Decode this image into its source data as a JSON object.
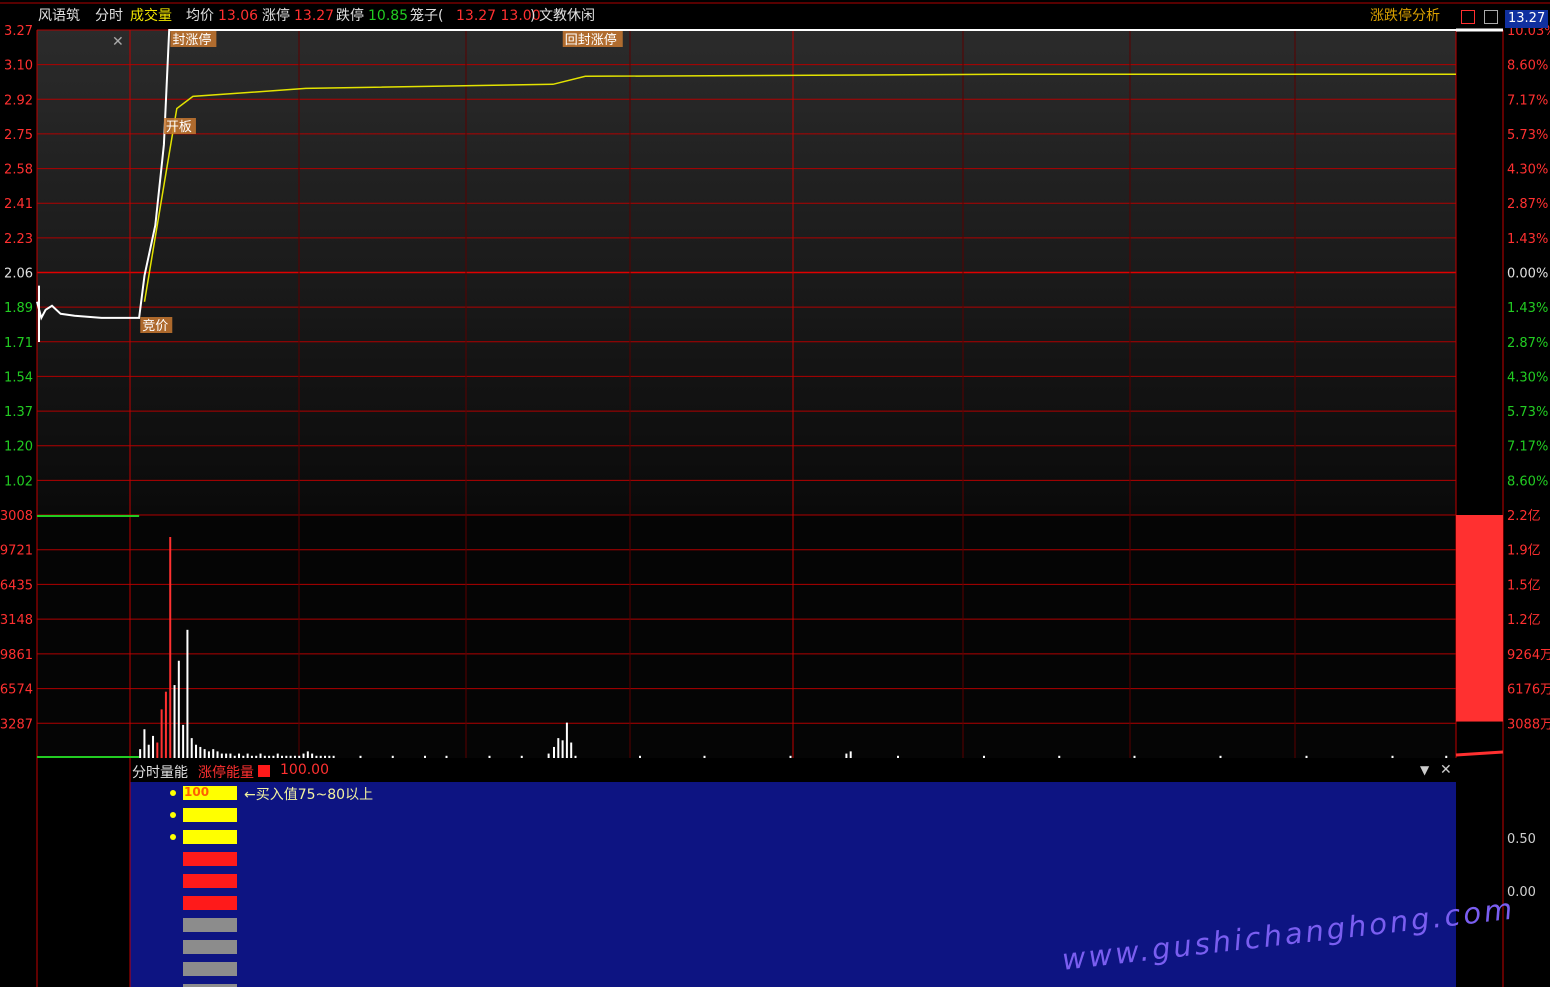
{
  "header": {
    "stock_name": "风语筑",
    "mode": "分时",
    "volume_tab": "成交量",
    "avg_label": "均价",
    "avg_value": "13.06",
    "limit_up_label": "涨停",
    "limit_up_value": "13.27",
    "limit_down_label": "跌停",
    "limit_down_value": "10.85",
    "cage_label": "笼子(",
    "cage_values": "13.27 13.00",
    "cage_close": ")",
    "sector": "文教休闲",
    "analysis_link": "涨跌停分析",
    "price_badge": "13.27"
  },
  "chart_data": [
    {
      "type": "line",
      "name": "intraday-price",
      "left_axis_ticks": [
        "3.27",
        "3.10",
        "2.92",
        "2.75",
        "2.58",
        "2.41",
        "2.23",
        "2.06",
        "1.89",
        "1.71",
        "1.54",
        "1.37",
        "1.20",
        "1.02"
      ],
      "right_axis_ticks": [
        "10.03%",
        "8.60%",
        "7.17%",
        "5.73%",
        "4.30%",
        "2.87%",
        "1.43%",
        "0.00%",
        "1.43%",
        "2.87%",
        "4.30%",
        "5.73%",
        "7.17%",
        "8.60%"
      ],
      "annotations": [
        "封涨停",
        "开板",
        "竞价",
        "回封涨停"
      ],
      "price_line": [
        [
          0,
          1.92
        ],
        [
          4,
          1.84
        ],
        [
          8,
          1.88
        ],
        [
          14,
          1.9
        ],
        [
          22,
          1.86
        ],
        [
          35,
          1.85
        ],
        [
          60,
          1.84
        ],
        [
          95,
          1.84
        ],
        [
          100,
          2.05
        ],
        [
          110,
          2.3
        ],
        [
          118,
          2.7
        ],
        [
          123,
          3.27
        ],
        [
          200,
          3.27
        ],
        [
          1320,
          3.27
        ]
      ],
      "avg_line": [
        [
          100,
          1.92
        ],
        [
          115,
          2.4
        ],
        [
          130,
          2.88
        ],
        [
          145,
          2.94
        ],
        [
          250,
          2.98
        ],
        [
          480,
          3.0
        ],
        [
          510,
          3.04
        ],
        [
          900,
          3.05
        ],
        [
          1320,
          3.05
        ]
      ],
      "auction_range": [
        1.72,
        2.0
      ],
      "grid": true
    },
    {
      "type": "bar",
      "name": "volume",
      "left_axis_ticks": [
        "3008",
        "9721",
        "6435",
        "3148",
        "9861",
        "6574",
        "3287"
      ],
      "right_axis_ticks": [
        "2.2亿",
        "1.9亿",
        "1.5亿",
        "1.2亿",
        "9264万",
        "6176万",
        "3088万"
      ],
      "volume_bars": [
        [
          95,
          0.04
        ],
        [
          99,
          0.13
        ],
        [
          103,
          0.06
        ],
        [
          107,
          0.1
        ],
        [
          111,
          0.07
        ],
        [
          115,
          0.22
        ],
        [
          119,
          0.3
        ],
        [
          123,
          1.0
        ],
        [
          127,
          0.33
        ],
        [
          131,
          0.44
        ],
        [
          135,
          0.15
        ],
        [
          139,
          0.58
        ],
        [
          143,
          0.09
        ],
        [
          147,
          0.06
        ],
        [
          151,
          0.05
        ],
        [
          155,
          0.04
        ],
        [
          159,
          0.03
        ],
        [
          163,
          0.04
        ],
        [
          167,
          0.03
        ],
        [
          171,
          0.02
        ],
        [
          175,
          0.02
        ],
        [
          179,
          0.02
        ],
        [
          183,
          0.01
        ],
        [
          187,
          0.02
        ],
        [
          191,
          0.01
        ],
        [
          195,
          0.02
        ],
        [
          199,
          0.01
        ],
        [
          203,
          0.01
        ],
        [
          207,
          0.02
        ],
        [
          211,
          0.01
        ],
        [
          215,
          0.01
        ],
        [
          219,
          0.01
        ],
        [
          223,
          0.02
        ],
        [
          227,
          0.01
        ],
        [
          231,
          0.01
        ],
        [
          235,
          0.01
        ],
        [
          239,
          0.01
        ],
        [
          243,
          0.01
        ],
        [
          247,
          0.02
        ],
        [
          251,
          0.03
        ],
        [
          255,
          0.02
        ],
        [
          259,
          0.01
        ],
        [
          263,
          0.01
        ],
        [
          267,
          0.01
        ],
        [
          271,
          0.01
        ],
        [
          275,
          0.01
        ],
        [
          300,
          0.01
        ],
        [
          330,
          0.01
        ],
        [
          360,
          0.01
        ],
        [
          380,
          0.01
        ],
        [
          420,
          0.01
        ],
        [
          450,
          0.01
        ],
        [
          475,
          0.02
        ],
        [
          480,
          0.05
        ],
        [
          484,
          0.09
        ],
        [
          488,
          0.08
        ],
        [
          492,
          0.16
        ],
        [
          496,
          0.07
        ],
        [
          500,
          0.01
        ],
        [
          560,
          0.01
        ],
        [
          620,
          0.01
        ],
        [
          700,
          0.01
        ],
        [
          752,
          0.02
        ],
        [
          756,
          0.03
        ],
        [
          800,
          0.01
        ],
        [
          880,
          0.01
        ],
        [
          950,
          0.01
        ],
        [
          1020,
          0.01
        ],
        [
          1100,
          0.01
        ],
        [
          1180,
          0.01
        ],
        [
          1260,
          0.01
        ],
        [
          1310,
          0.01
        ]
      ],
      "side_bar_level": 0.85
    },
    {
      "type": "bar",
      "name": "分时量能",
      "right_axis_ticks": [
        "0.50",
        "0.00"
      ],
      "legend_value": "100.00",
      "energy_bars": [
        {
          "color": "#ffff00",
          "label": "100"
        },
        {
          "color": "#ffff00",
          "label": ""
        },
        {
          "color": "#ffff00",
          "label": ""
        },
        {
          "color": "#ff1a1a",
          "label": ""
        },
        {
          "color": "#ff1a1a",
          "label": ""
        },
        {
          "color": "#ff1a1a",
          "label": ""
        },
        {
          "color": "#8c8c8c",
          "label": ""
        },
        {
          "color": "#8c8c8c",
          "label": ""
        },
        {
          "color": "#8c8c8c",
          "label": ""
        },
        {
          "color": "#8c8c8c",
          "label": ""
        }
      ]
    }
  ],
  "panel": {
    "title": "分时量能",
    "indicator_name": "涨停能量",
    "indicator_value": "100.00",
    "note": "←买入值75~80以上"
  },
  "colors": {
    "grid_red": "#b00000",
    "price_line": "#ffffff",
    "avg_line": "#e3e300",
    "panel_blue": "#0d1482",
    "up_green": "#22cc22",
    "limit_red": "#ff3030"
  },
  "watermark": "www.gushichanghong.com"
}
